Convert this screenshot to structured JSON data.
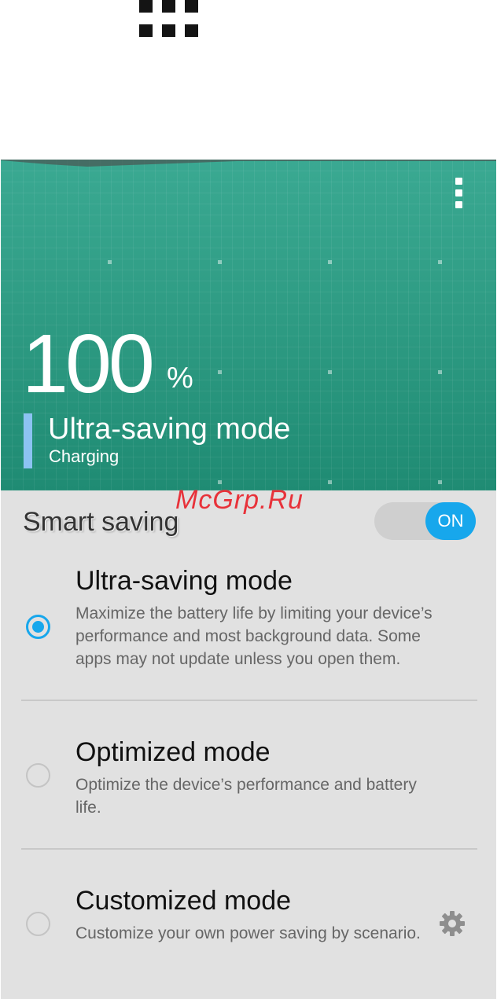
{
  "header": {
    "percent": "100",
    "percent_sign": "%",
    "mode_title": "Ultra-saving mode",
    "mode_status": "Charging",
    "theme_color": "#2f9d85",
    "indicator_color": "#8cc3f2"
  },
  "watermark": "McGrp.Ru",
  "smart_saving": {
    "label": "Smart saving",
    "toggle_label": "ON",
    "toggle_on": true,
    "accent_color": "#17a7ec"
  },
  "modes": [
    {
      "title": "Ultra-saving mode",
      "description": "Maximize the battery life by limiting your device’s performance and most background data. Some apps may not update unless you open them.",
      "selected": true
    },
    {
      "title": "Optimized mode",
      "description": "Optimize the device’s performance and battery life.",
      "selected": false
    },
    {
      "title": "Customized mode",
      "description": "Customize your own power saving by scenario.",
      "selected": false,
      "settings_icon": "gear-icon"
    }
  ],
  "icons": [
    "app-grid-icon",
    "overflow-menu-icon",
    "gear-icon"
  ]
}
